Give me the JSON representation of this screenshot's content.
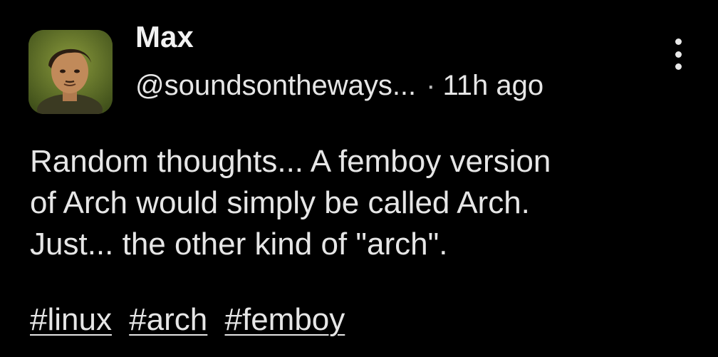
{
  "post": {
    "author": {
      "name": "Max",
      "handle": "@soundsontheways...",
      "avatar_icon": "user-avatar-photo"
    },
    "separator": "·",
    "timestamp": "11h ago",
    "more_icon": "more-vertical-icon",
    "body_lines": [
      "Random thoughts... A femboy version",
      "of Arch would simply be called Arch.",
      "Just... the other kind of \"arch\"."
    ],
    "tags": [
      "#linux",
      "#arch",
      "#femboy"
    ]
  },
  "colors": {
    "background": "#000000",
    "text": "#e6e6e6"
  }
}
